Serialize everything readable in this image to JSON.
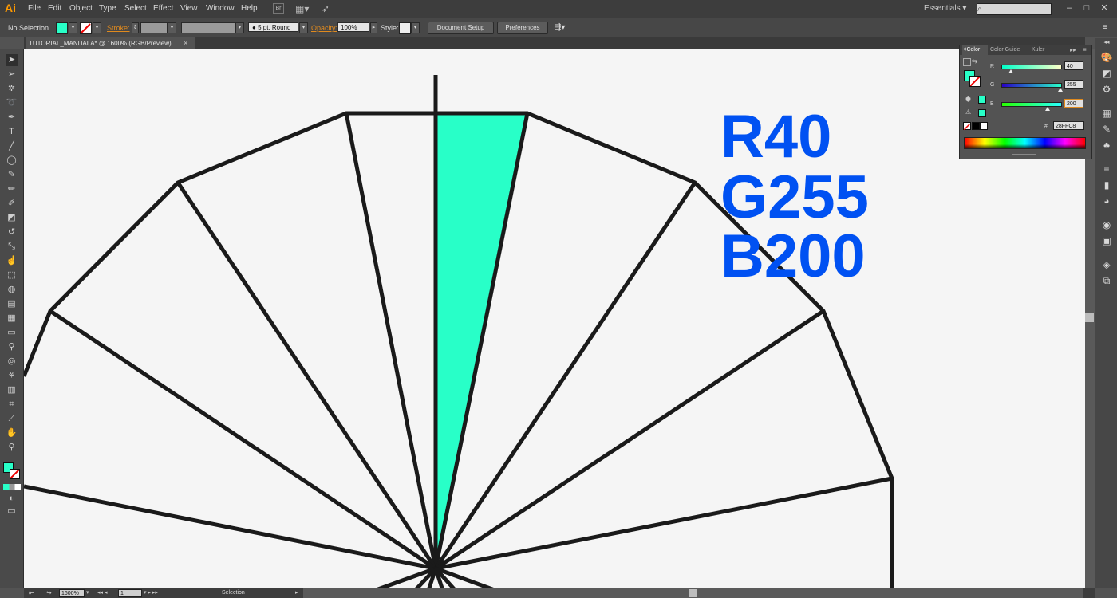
{
  "app": {
    "logo": "Ai",
    "accent": "#ff9a00"
  },
  "menu": [
    "File",
    "Edit",
    "Object",
    "Type",
    "Select",
    "Effect",
    "View",
    "Window",
    "Help"
  ],
  "menubar_icons": [
    "bridge-icon",
    "arrange-documents-icon",
    "gpu-performance-icon"
  ],
  "workspace": {
    "label": "Essentials",
    "search_placeholder": ""
  },
  "control": {
    "selection": "No Selection",
    "fill_color": "#28FFC8",
    "stroke_label": "Stroke:",
    "brush": "5 pt. Round",
    "opacity_label": "Opacity:",
    "opacity": "100%",
    "style_label": "Style:",
    "doc_setup": "Document Setup",
    "preferences": "Preferences"
  },
  "document": {
    "tab": "TUTORIAL_MANDALA* @ 1600% (RGB/Preview)",
    "close": "×"
  },
  "tools": [
    "selection-tool",
    "direct-selection-tool",
    "magic-wand-tool",
    "lasso-tool",
    "pen-tool",
    "type-tool",
    "line-tool",
    "rectangle-tool",
    "paintbrush-tool",
    "pencil-tool",
    "blob-brush-tool",
    "eraser-tool",
    "rotate-tool",
    "scale-tool",
    "warp-tool",
    "free-transform-tool",
    "shape-builder-tool",
    "perspective-grid-tool",
    "mesh-tool",
    "gradient-tool",
    "eyedropper-tool",
    "blend-tool",
    "symbol-sprayer-tool",
    "column-graph-tool",
    "artboard-tool",
    "slice-tool",
    "hand-tool",
    "zoom-tool"
  ],
  "color_panel": {
    "tabs": [
      "Color",
      "Color Guide",
      "Kuler"
    ],
    "r_label": "R",
    "g_label": "G",
    "b_label": "B",
    "r": "40",
    "g": "255",
    "b": "200",
    "r_frac": 0.157,
    "g_frac": 1.0,
    "b_frac": 0.784,
    "hex_label": "#",
    "hex": "28FFC8"
  },
  "overlay": {
    "r_text": "R40",
    "g_text": "G255",
    "b_text": "B200",
    "color": "#0051f2"
  },
  "status": {
    "zoom": "1600%",
    "artboard": "1",
    "tool": "Selection"
  },
  "artwork": {
    "stroke": "#1a1a1a",
    "segment_fill": "#28FFC8",
    "canvas": "#f5f5f5"
  }
}
